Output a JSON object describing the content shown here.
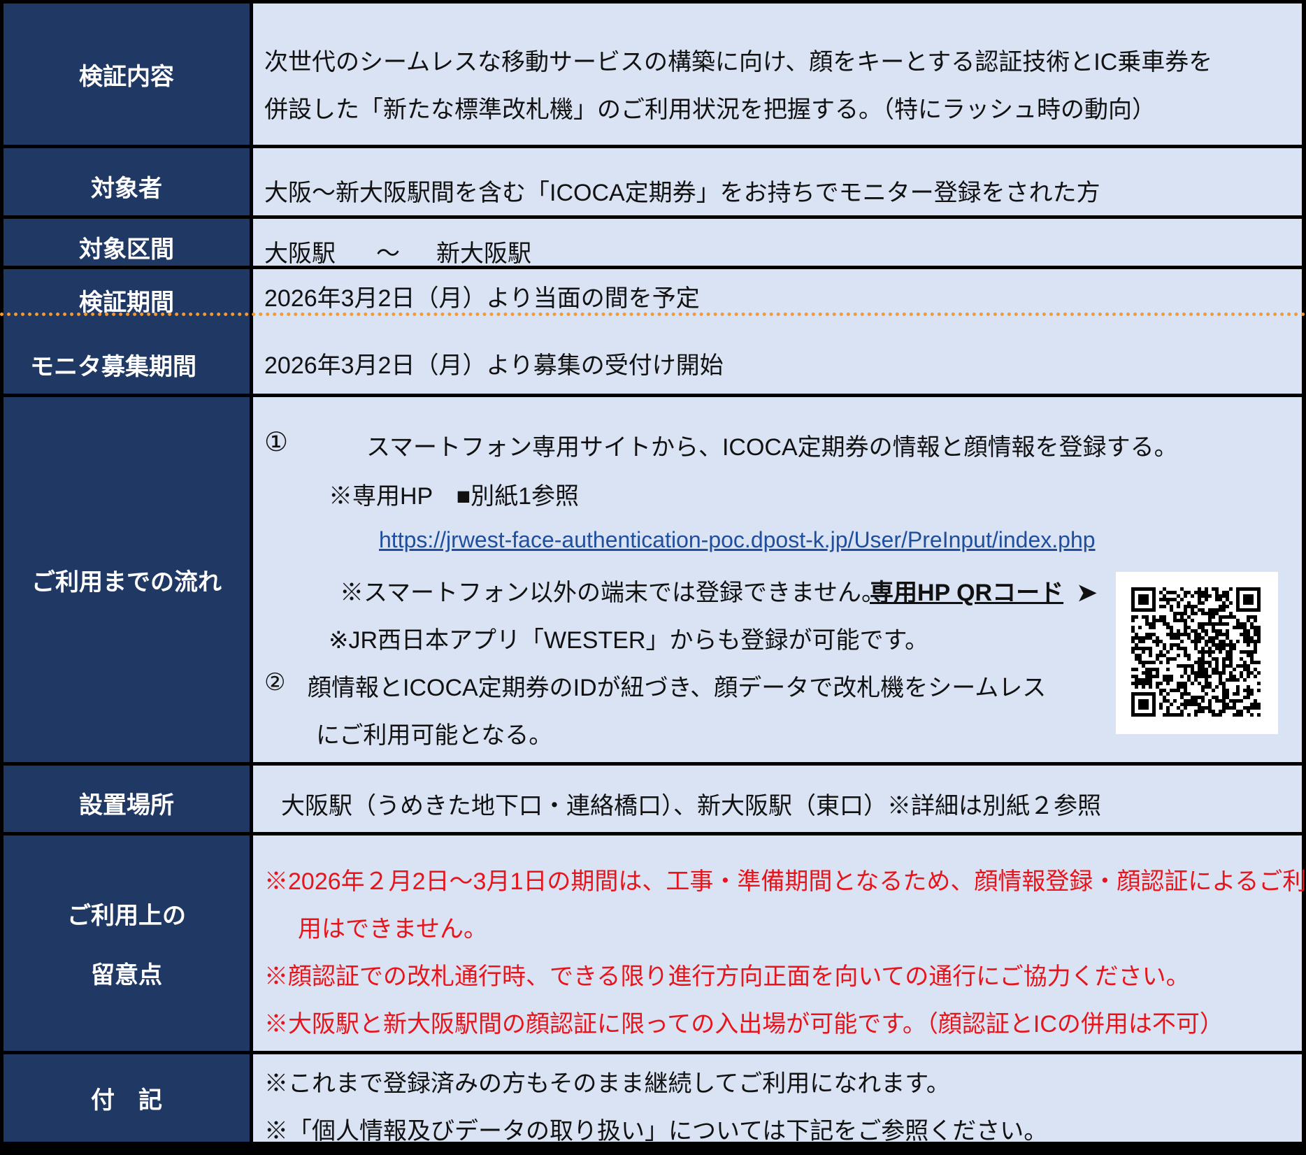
{
  "rows": {
    "verification": {
      "heading": "検証内容",
      "line1": "次世代のシームレスな移動サービスの構築に向け、顔をキーとする認証技術とIC乗車券を",
      "line2": "併設した「新たな標準改札機」のご利用状況を把握する。（特にラッシュ時の動向）"
    },
    "target": {
      "heading": "対象者",
      "text": "大阪～新大阪駅間を含む「ICOCA定期券」をお持ちでモニター登録をされた方"
    },
    "section": {
      "heading": "対象区間",
      "from": "大阪駅",
      "sep": "～",
      "to": "新大阪駅"
    },
    "period": {
      "heading": "検証期間",
      "text": "2026年3月2日（月）より当面の間を予定"
    },
    "recruit": {
      "heading": "モニタ募集期間",
      "text": "2026年3月2日（月）より募集の受付け開始"
    },
    "flow": {
      "heading": "ご利用までの流れ",
      "step1_num": "①",
      "step1": "スマートフォン専用サイトから、ICOCA定期券の情報と顔情報を登録する。",
      "hp_note": "※専用HP　■別紙1参照",
      "url": "https://jrwest-face-authentication-poc.dpost-k.jp/User/PreInput/index.php",
      "device_note": "※スマートフォン以外の端末では登録できません。",
      "qr_label": "専用HP QRコード",
      "qr_arrow": "➤",
      "app_note": "※JR西日本アプリ「WESTER」からも登録が可能です。",
      "step2_num": "②",
      "step2_line1": "顔情報とICOCA定期券のIDが紐づき、顔データで改札機をシームレス",
      "step2_line2": "にご利用可能となる。"
    },
    "location": {
      "heading": "設置場所",
      "text": "大阪駅（うめきた地下口・連絡橋口）、新大阪駅（東口）※詳細は別紙２参照"
    },
    "caution": {
      "heading_line1": "ご利用上の",
      "heading_line2": "留意点",
      "line1": "※2026年２月2日～3月1日の期間は、工事・準備期間となるため、顔情報登録・顔認証によるご利",
      "line1b": "用はできません。",
      "line2": "※顔認証での改札通行時、できる限り進行方向正面を向いての通行にご協力ください。",
      "line3": "※大阪駅と新大阪駅間の顔認証に限っての入出場が可能です。（顔認証とICの併用は不可）"
    },
    "notes": {
      "heading": "付　記",
      "line1": "※これまで登録済みの方もそのまま継続してご利用になれます。",
      "line2": "※「個人情報及びデータの取り扱い」については下記をご参照ください。"
    }
  },
  "colors": {
    "header_bg": "#1f3864",
    "cell_bg": "#dae3f3",
    "warning_text": "#e8141b",
    "link": "#1f4e9c",
    "divider": "#f39a35"
  },
  "icons": {
    "qr": "qr-code-icon"
  }
}
